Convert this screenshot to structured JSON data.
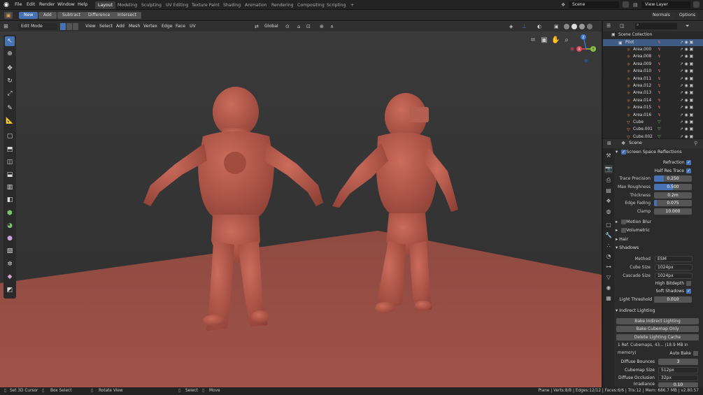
{
  "menubar": {
    "items": [
      "File",
      "Edit",
      "Render",
      "Window",
      "Help"
    ]
  },
  "workspaces": [
    "Layout",
    "Modeling",
    "Sculpting",
    "UV Editing",
    "Texture Paint",
    "Shading",
    "Animation",
    "Rendering",
    "Compositing",
    "Scripting"
  ],
  "add_workspace": "+",
  "scene": "Scene",
  "view_layer": "View Layer",
  "boolbar": {
    "buttons": [
      "New",
      "Add",
      "Subtract",
      "Difference",
      "Intersect"
    ],
    "normals": "Normals",
    "options": "Options"
  },
  "viewport_header": {
    "mode": "Edit Mode",
    "menus": [
      "View",
      "Select",
      "Add",
      "Mesh",
      "Vertex",
      "Edge",
      "Face",
      "UV"
    ],
    "orientation": "Global"
  },
  "gizmo": {
    "x": "X",
    "y": "Y",
    "z": "Z"
  },
  "outliner": {
    "search_placeholder": "",
    "collection": "Scene Collection",
    "items": [
      "Pilot",
      "Area.000",
      "Area.008",
      "Area.009",
      "Area.010",
      "Area.011",
      "Area.012",
      "Area.013",
      "Area.014",
      "Area.015",
      "Area.016",
      "Cube",
      "Cube.001",
      "Cube.002"
    ]
  },
  "properties": {
    "scene_label": "Scene",
    "ssr": {
      "title": "Screen Space Reflections",
      "refraction": "Refraction",
      "half_res": "Half Res Trace",
      "trace_precision_label": "Trace Precision",
      "trace_precision": "0.250",
      "trace_precision_frac": 0.25,
      "max_roughness_label": "Max Roughness",
      "max_roughness": "0.500",
      "max_roughness_frac": 0.5,
      "thickness_label": "Thickness",
      "thickness": "0.2m",
      "edge_fading_label": "Edge Fading",
      "edge_fading": "0.075",
      "edge_fading_frac": 0.075,
      "clamp_label": "Clamp",
      "clamp": "10.000"
    },
    "motion_blur": "Motion Blur",
    "volumetric": "Volumetric",
    "hair": "Hair",
    "shadows": {
      "title": "Shadows",
      "method_label": "Method",
      "method": "ESM",
      "cube_size_label": "Cube Size",
      "cube_size": "1024px",
      "cascade_size_label": "Cascade Size",
      "cascade_size": "1024px",
      "high_bitdepth": "High Bitdepth",
      "soft_shadows": "Soft Shadows",
      "light_threshold_label": "Light Threshold",
      "light_threshold": "0.010"
    },
    "indirect": {
      "title": "Indirect Lighting",
      "bake_indirect": "Bake Indirect Lighting",
      "bake_cubemap": "Bake Cubemap Only",
      "delete_cache": "Delete Lighting Cache",
      "info": "1 Ref. Cubemaps, 43... (18.9 MB in memory)",
      "auto_bake": "Auto Bake",
      "diffuse_bounces_label": "Diffuse Bounces",
      "diffuse_bounces": "3",
      "cubemap_size_label": "Cubemap Size",
      "cubemap_size": "512px",
      "diffuse_occlusion_label": "Diffuse Occlusion",
      "diffuse_occlusion": "32px",
      "irradiance_label": "Irradiance Smoothing",
      "irradiance": "0.10"
    }
  },
  "statusbar": {
    "set_cursor": "Set 3D Cursor",
    "box_select": "Box Select",
    "rotate_view": "Rotate View",
    "select": "Select",
    "move": "Move",
    "stats": "Plane | Verts:8/8 | Edges:12/12 | Faces:6/6 | Tris:12 | Mem: 686.7 MB | v2.80.57"
  },
  "colors": {
    "accent": "#4772b3",
    "clay": "#b85a4c",
    "floor": "#9c4f44",
    "bg": "#3a3a3a"
  }
}
